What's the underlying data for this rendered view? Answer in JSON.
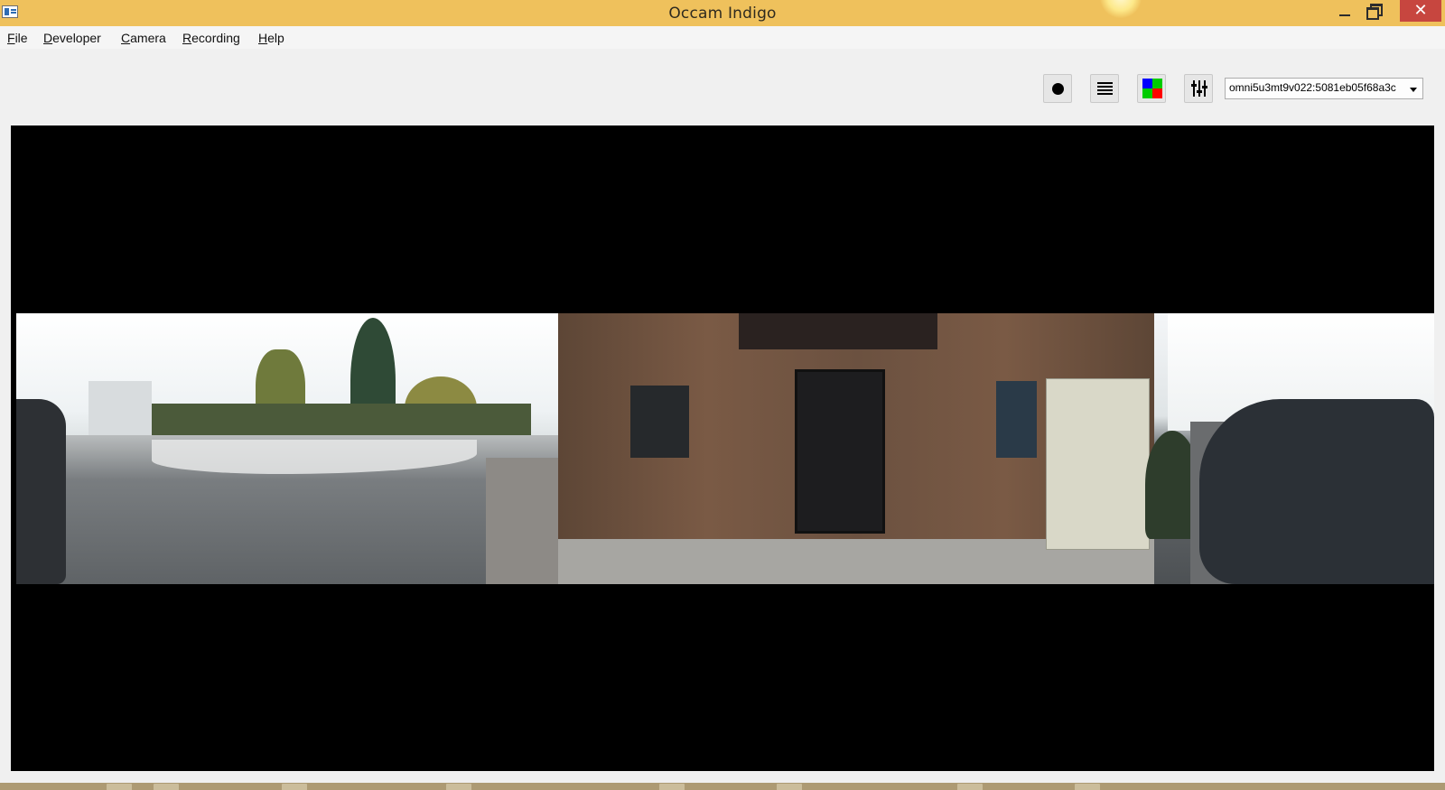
{
  "window": {
    "title": "Occam Indigo",
    "close_glyph": "✕"
  },
  "menu": {
    "items": [
      {
        "label": "File"
      },
      {
        "label": "Developer"
      },
      {
        "label": "Camera"
      },
      {
        "label": "Recording"
      },
      {
        "label": "Help"
      }
    ]
  },
  "toolbar": {
    "buttons": [
      {
        "icon": "record-dot-icon"
      },
      {
        "icon": "list-lines-icon"
      },
      {
        "icon": "color-grid-icon",
        "colors": [
          "#0000ff",
          "#00cc00",
          "#00cc00",
          "#ff0000"
        ]
      },
      {
        "icon": "sliders-icon"
      }
    ],
    "device_selector": {
      "value": "omni5u3mt9v022:5081eb05f68a3c"
    }
  },
  "colors": {
    "titlebar": "#efc15c",
    "close_button": "#c7463f",
    "viewer_background": "#000000"
  }
}
